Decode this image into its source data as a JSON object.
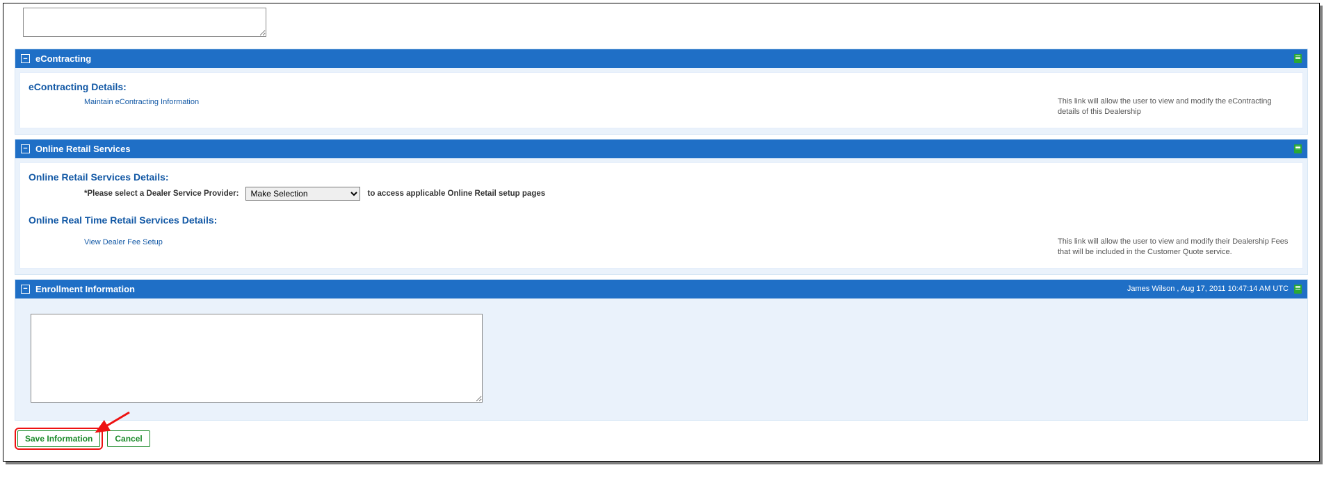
{
  "topNotes": {
    "value": ""
  },
  "sections": {
    "econtracting": {
      "title": "eContracting",
      "collapseGlyph": "−",
      "details": {
        "heading": "eContracting Details:",
        "linkLabel": "Maintain eContracting Information",
        "description": "This link will allow the user to view and modify the eContracting details of this Dealership"
      }
    },
    "onlineRetail": {
      "title": "Online Retail Services",
      "collapseGlyph": "−",
      "details": {
        "heading": "Online Retail Services Details:",
        "providerLabel": "*Please select a Dealer Service Provider:",
        "providerSelected": "Make Selection",
        "afterSelect": "to access applicable Online Retail setup pages"
      },
      "realtime": {
        "heading": "Online Real Time Retail Services Details:",
        "linkLabel": "View Dealer Fee Setup",
        "description": "This link will allow the user to view and modify their Dealership Fees that will be included in the Customer Quote service."
      }
    },
    "enrollment": {
      "title": "Enrollment Information",
      "collapseGlyph": "−",
      "timestamp": "James Wilson , Aug 17, 2011 10:47:14 AM UTC",
      "notesValue": ""
    }
  },
  "buttons": {
    "save": "Save Information",
    "cancel": "Cancel"
  }
}
